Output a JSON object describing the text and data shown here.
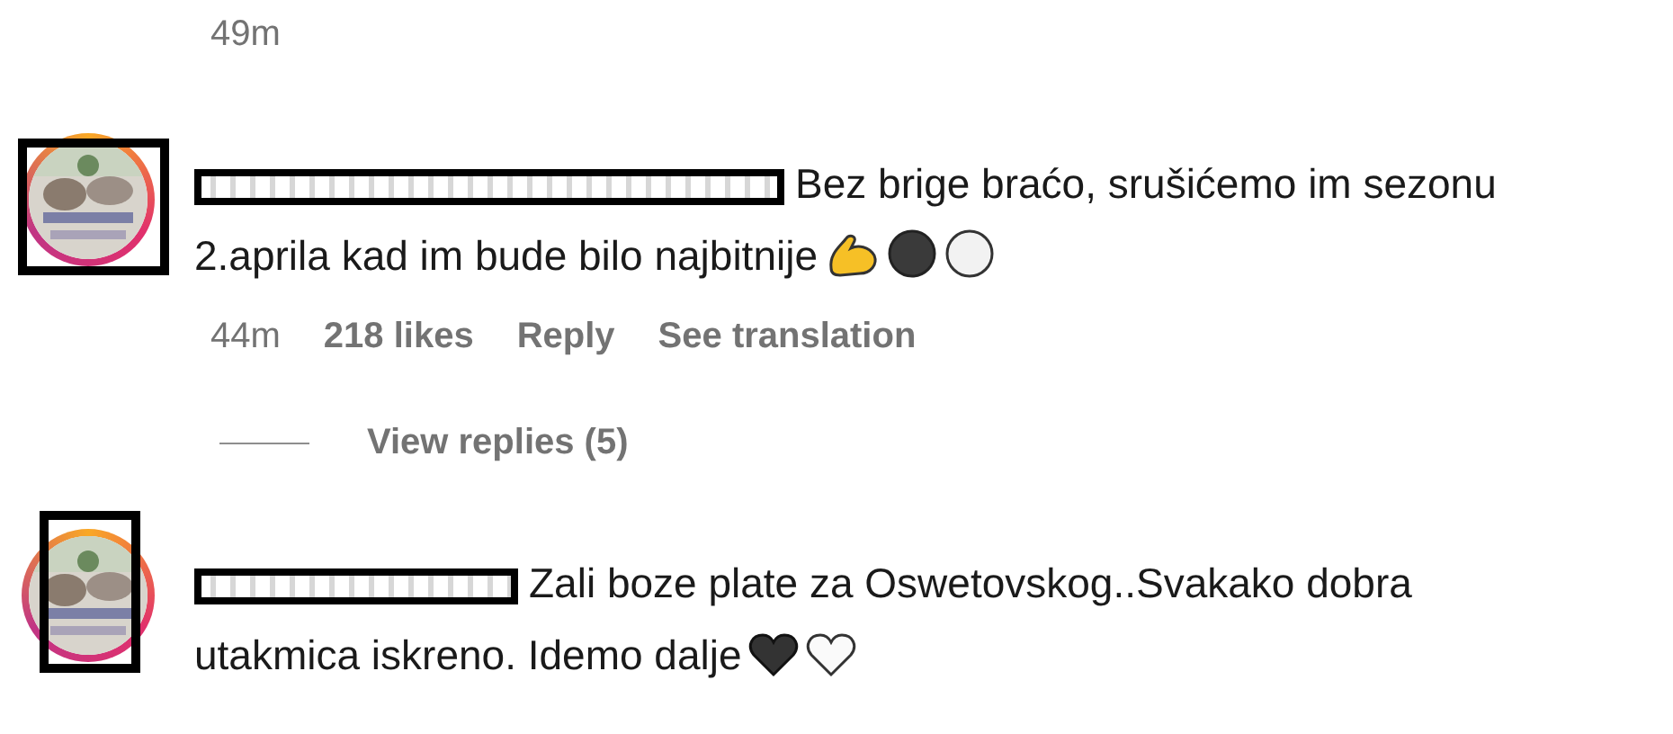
{
  "previous_comment": {
    "time": "49m"
  },
  "comments": [
    {
      "username_redacted": true,
      "text": "Bez brige braćo, srušićemo im sezonu 2.aprila kad im bude bilo najbitnije",
      "emojis": [
        {
          "kind": "biceps"
        },
        {
          "kind": "black-circle"
        },
        {
          "kind": "white-circle"
        }
      ],
      "time": "44m",
      "likes": "218 likes",
      "reply": "Reply",
      "translate": "See translation",
      "view_replies": "View replies (5)"
    },
    {
      "username_redacted": true,
      "text": "Zali boze plate za Oswetovskog..Svakako dobra utakmica iskreno. Idemo dalje",
      "emojis": [
        {
          "kind": "black-heart"
        },
        {
          "kind": "white-heart"
        }
      ]
    }
  ]
}
